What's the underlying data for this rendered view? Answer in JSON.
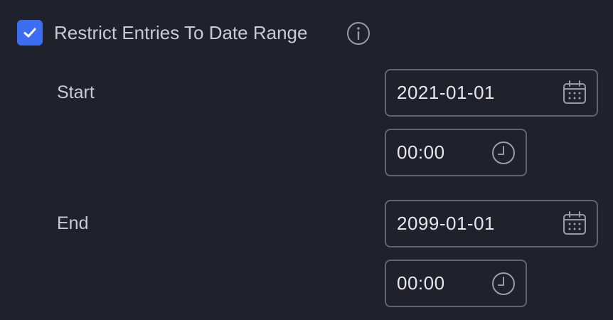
{
  "restrict": {
    "label": "Restrict Entries To Date Range",
    "checked": true,
    "info_icon": "info-icon",
    "accent_color": "#3d6df2"
  },
  "start": {
    "label": "Start",
    "date_value": "2021-01-01",
    "time_value": "00:00",
    "date_icon": "calendar-icon",
    "time_icon": "clock-icon"
  },
  "end": {
    "label": "End",
    "date_value": "2099-01-01",
    "time_value": "00:00",
    "date_icon": "calendar-icon",
    "time_icon": "clock-icon"
  }
}
